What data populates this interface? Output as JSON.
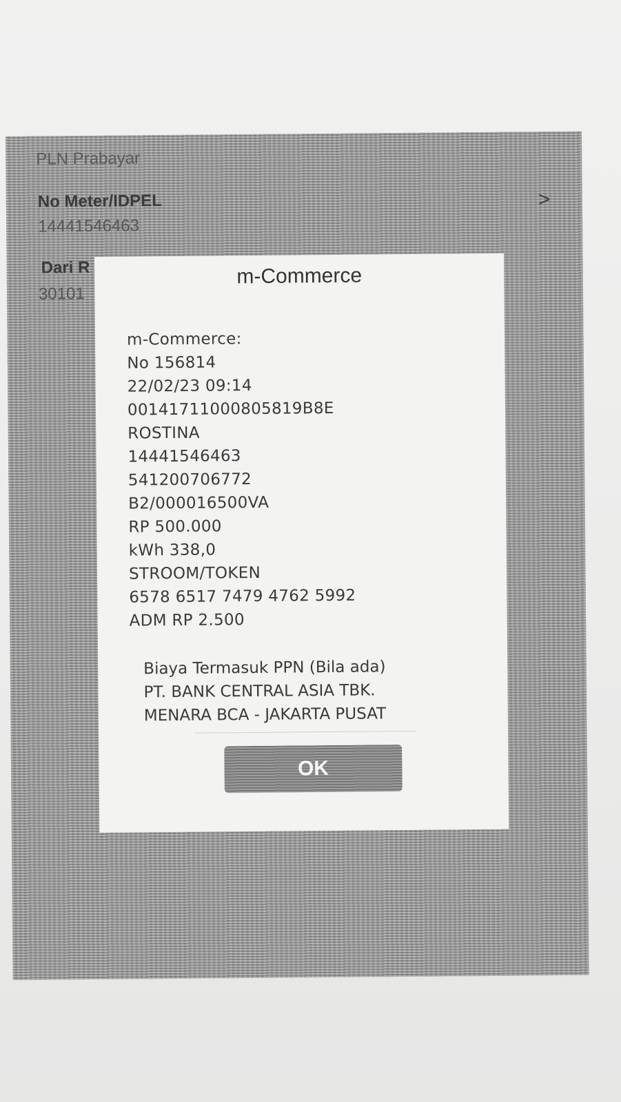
{
  "background_screen": {
    "service_name": "PLN Prabayar",
    "meter_label": "No Meter/IDPEL",
    "meter_value": "14441546463",
    "from_account_label": "Dari R",
    "from_account_value": "30101",
    "chevron": ">"
  },
  "dialog": {
    "title": "m-Commerce",
    "lines": [
      "m-Commerce:",
      "No 156814",
      "22/02/23 09:14",
      "00141711000805819B8E",
      "ROSTINA",
      "14441546463",
      "541200706772",
      "B2/000016500VA",
      "RP 500.000",
      "kWh 338,0",
      "STROOM/TOKEN",
      "6578 6517 7479 4762 5992",
      "ADM RP 2.500"
    ],
    "footer_lines": [
      "Biaya Termasuk PPN (Bila ada)",
      "PT. BANK CENTRAL ASIA TBK.",
      "MENARA BCA - JAKARTA PUSAT"
    ],
    "ok_label": "OK"
  },
  "icons": {
    "chevron": "chevron-right-icon"
  }
}
